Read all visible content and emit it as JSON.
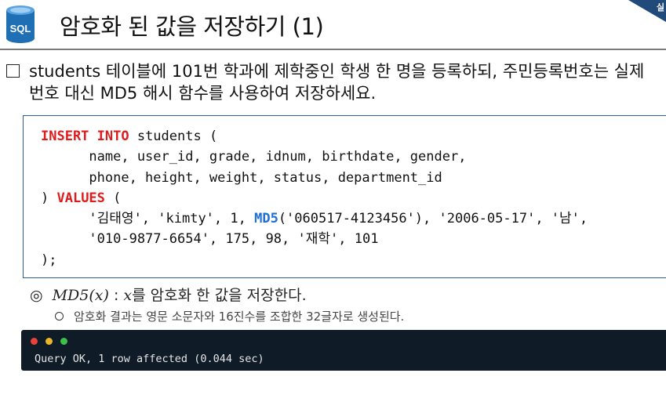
{
  "header": {
    "icon_label": "SQL",
    "title": "암호화 된 값을 저장하기 (1)",
    "corner_text": "실"
  },
  "question": {
    "line1": "students 테이블에 101번 학과에 제학중인 학생 한 명을 등록하되, 주민등록번호는 실제",
    "line2": "번호 대신 MD5 해시 함수를 사용하여 저장하세요."
  },
  "code": {
    "l1_kw": "INSERT INTO",
    "l1_rest": " students (",
    "l2": "      name, user_id, grade, idnum, birthdate, gender,",
    "l3": "      phone, height, weight, status, department_id",
    "l4_pre": ") ",
    "l4_kw": "VALUES",
    "l4_rest": " (",
    "l5_pre": "      '김태영', 'kimty', 1, ",
    "l5_fn": "MD5",
    "l5_rest": "('060517-4123456'), '2006-05-17', '남',",
    "l6": "      '010-9877-6654', 175, 98, '재학', 101",
    "l7": ");"
  },
  "notes": {
    "note1_symbol": "◎",
    "note1_math": "MD5(x)",
    "note1_sep": " : ",
    "note1_var": "x",
    "note1_text": "를 암호화 한 값을 저장한다.",
    "note2_text": "암호화 결과는 영문 소문자와 16진수를 조합한 32글자로 생성된다."
  },
  "terminal": {
    "output": "Query OK, 1 row affected (0.044 sec)"
  },
  "colors": {
    "keyword": "#e01b1b",
    "function": "#1e6fd6",
    "code_border": "#2f5b96",
    "terminal_bg": "#0f1b26",
    "sql_icon": "#1f6fb5"
  }
}
